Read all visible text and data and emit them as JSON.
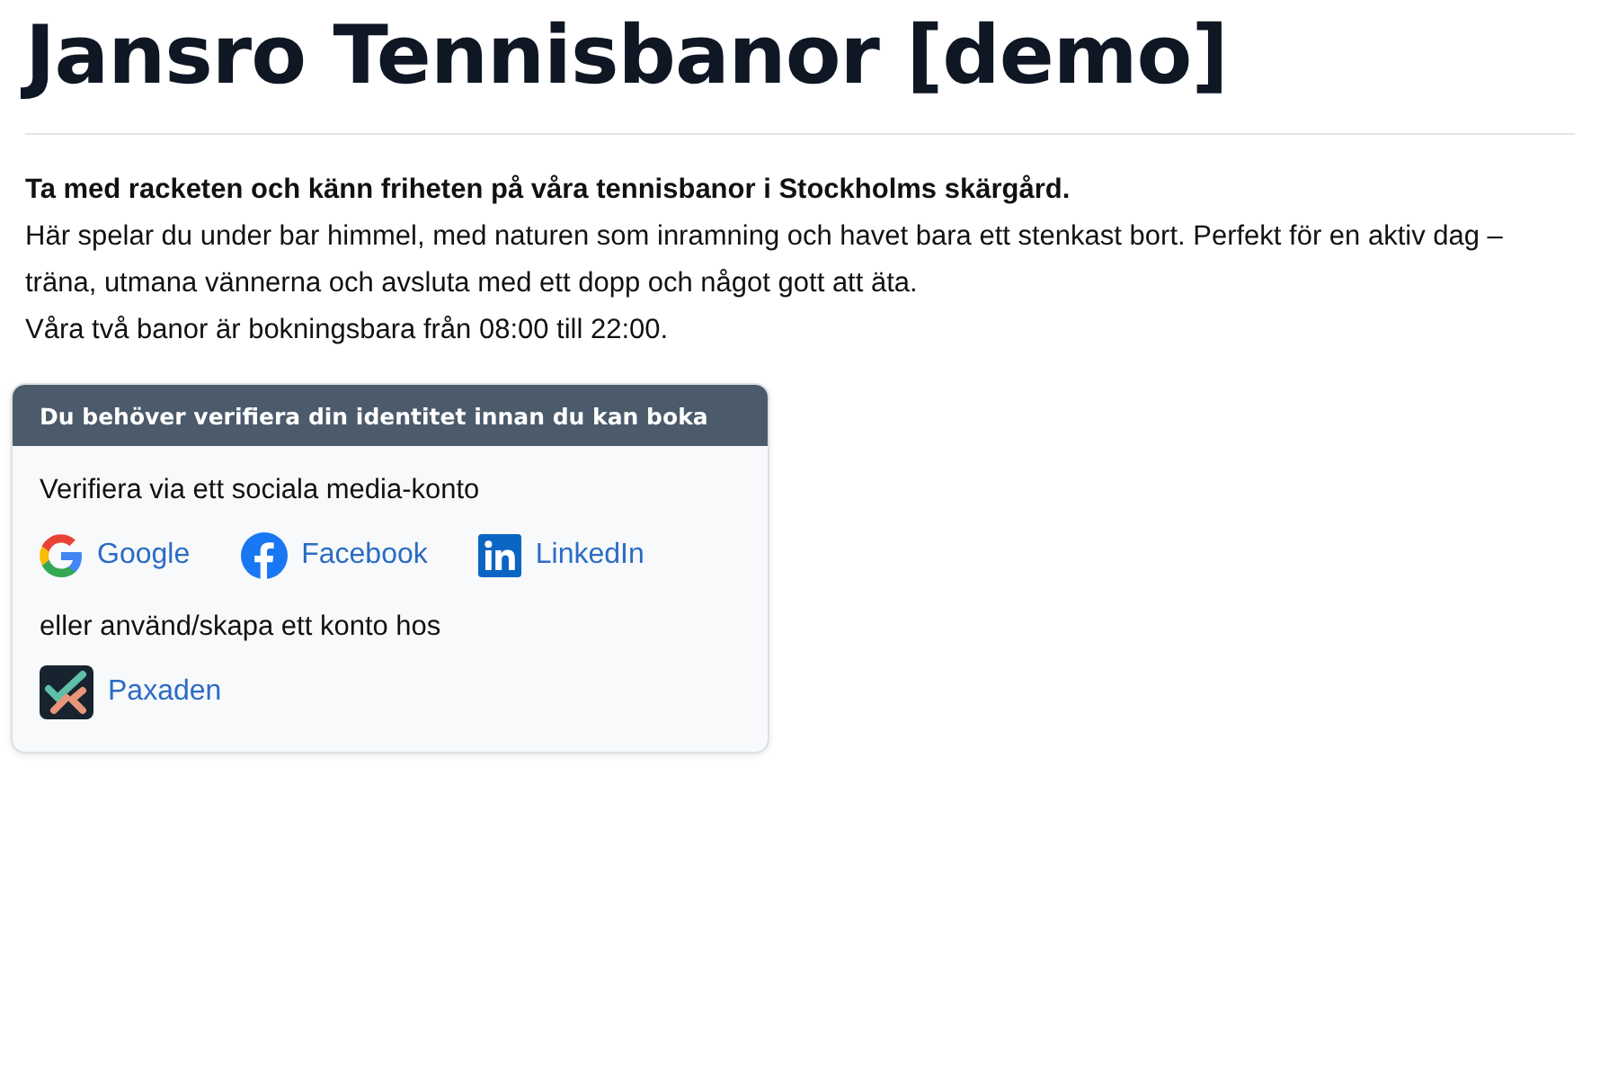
{
  "title": "Jansro Tennisbanor [demo]",
  "intro": {
    "lead": "Ta med racketen och känn friheten på våra tennisbanor i Stockholms skärgård.",
    "description": "Här spelar du under bar himmel, med naturen som inramning och havet bara ett stenkast bort. Perfekt för en aktiv dag – träna, utmana vännerna och avsluta med ett dopp och något gott att äta.",
    "hours": "Våra två banor är bokningsbara från 08:00 till 22:00."
  },
  "verify_card": {
    "header": "Du behöver verifiera din identitet innan du kan boka",
    "social_label": "Verifiera via ett sociala media-konto",
    "social_links": [
      {
        "kind": "google",
        "label": "Google"
      },
      {
        "kind": "facebook",
        "label": "Facebook"
      },
      {
        "kind": "linkedin",
        "label": "LinkedIn"
      }
    ],
    "account_label": "eller använd/skapa ett konto hos",
    "account_links": [
      {
        "kind": "paxaden",
        "label": "Paxaden"
      }
    ]
  }
}
